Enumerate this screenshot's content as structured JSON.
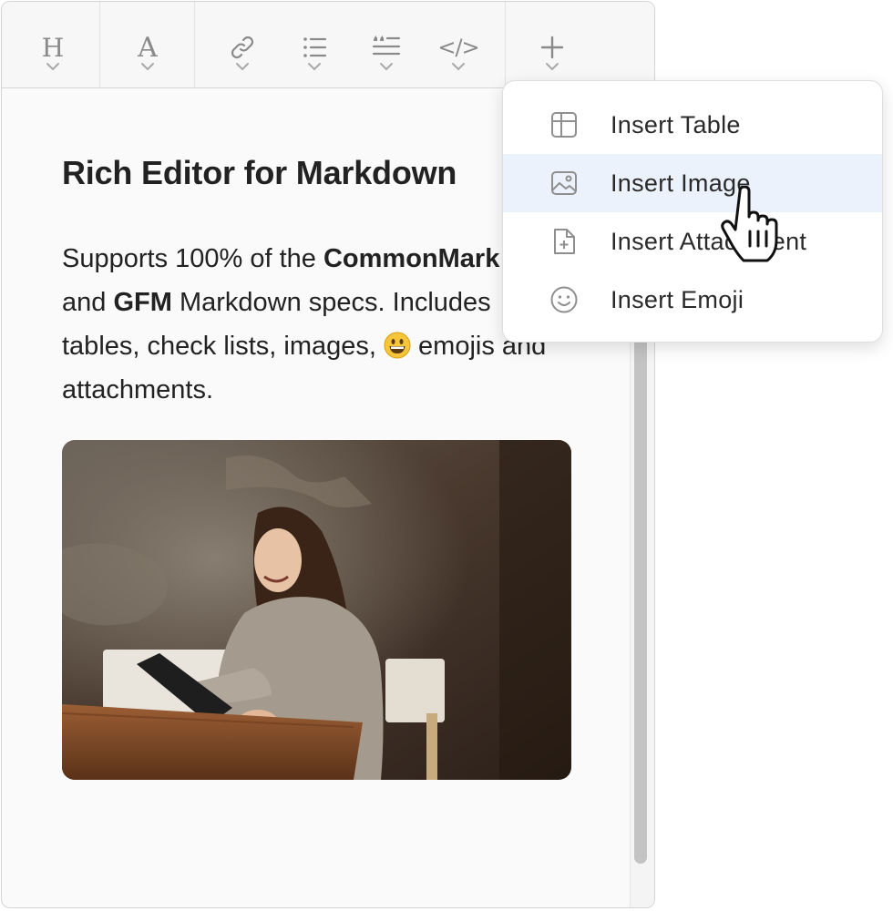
{
  "toolbar": {
    "buttons": [
      {
        "name": "heading",
        "icon": "heading-icon",
        "glyph": "H"
      },
      {
        "name": "font-style",
        "icon": "font-style-icon",
        "glyph": "A"
      },
      {
        "name": "link",
        "icon": "link-icon"
      },
      {
        "name": "list",
        "icon": "list-icon"
      },
      {
        "name": "quote",
        "icon": "quote-icon"
      },
      {
        "name": "code",
        "icon": "code-icon",
        "glyph": "</>"
      },
      {
        "name": "insert",
        "icon": "plus-icon",
        "glyph": "+"
      }
    ]
  },
  "document": {
    "title": "Rich Editor for Markdown",
    "paragraph": {
      "t1": "Supports 100% of the ",
      "b1": "CommonMark",
      "t2": "and ",
      "b2": "GFM",
      "t3": " Markdown specs. Includes tables, check lists, images, ",
      "emoji": "😀",
      "t4": " emojis and attachments."
    },
    "image_icon": "photo-woman-tablet-image"
  },
  "insert_menu": {
    "items": [
      {
        "label": "Insert Table",
        "icon": "table-icon"
      },
      {
        "label": "Insert Image",
        "icon": "image-icon"
      },
      {
        "label": "Insert Attachment",
        "icon": "attachment-icon"
      },
      {
        "label": "Insert Emoji",
        "icon": "emoji-icon"
      }
    ],
    "highlighted_item": "Insert Image"
  },
  "colors": {
    "icon_gray": "#8a8a8a",
    "highlight": "#ecf2fb",
    "scroll_thumb": "#c3c3c3"
  }
}
